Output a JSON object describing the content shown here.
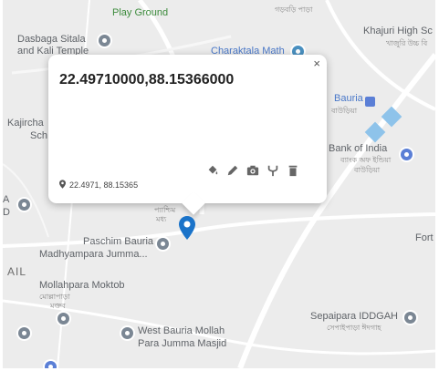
{
  "map": {
    "labels": {
      "play_ground": "Play Ground",
      "bengali_top": "গড়বড়ি পাড়া",
      "khajuri": "Khajuri High Sc",
      "khajuri_bn": "খাজুরি উচ্চ বি",
      "dasbaga_1": "Dasbaga Sitala",
      "dasbaga_2": "and Kali Temple",
      "charaktala": "Charaktala Math",
      "bauria": "Bauria",
      "bauria_bn": "বাউড়িয়া",
      "kajircha_1": "Kajircha",
      "kajircha_2": "Sch",
      "bank_1": "Bank of India",
      "bank_bn_1": "ব্যাংক অফ ইন্ডিয়া",
      "bank_bn_2": "বাউড়িয়া",
      "edge_a": "A",
      "edge_d": "D",
      "paschim_1": "Paschim Bauria",
      "paschim_2": "Madhyampara Jumma...",
      "near_bn_1": "প্যাশ্চিম",
      "near_bn_2": "মধ্য",
      "ail": "AIL",
      "fort": "Fort",
      "mollahpara": "Mollahpara Moktob",
      "mollahpara_bn_1": "মোল্লাপাড়া",
      "mollahpara_bn_2": "মক্তব",
      "west_1": "West Bauria Mollah",
      "west_2": "Para Jumma Masjid",
      "sepaipara": "Sepaipara IDDGAH",
      "sepaipara_bn": "সেপাইপাড়া ঈদগাহ"
    }
  },
  "popup": {
    "title": "22.49710000,88.15366000",
    "coords_short": "22.4971, 88.15365",
    "close_label": "×"
  },
  "icons": {
    "close": "close-icon",
    "location_pin": "location-pin-icon",
    "paint_bucket": "paint-bucket-icon",
    "pencil": "pencil-icon",
    "camera": "camera-icon",
    "fork": "fork-icon",
    "trash": "trash-icon",
    "map_marker": "map-marker-icon"
  },
  "colors": {
    "map_background": "#ececec",
    "marker": "#1a73c9",
    "popup_background": "#ffffff"
  }
}
